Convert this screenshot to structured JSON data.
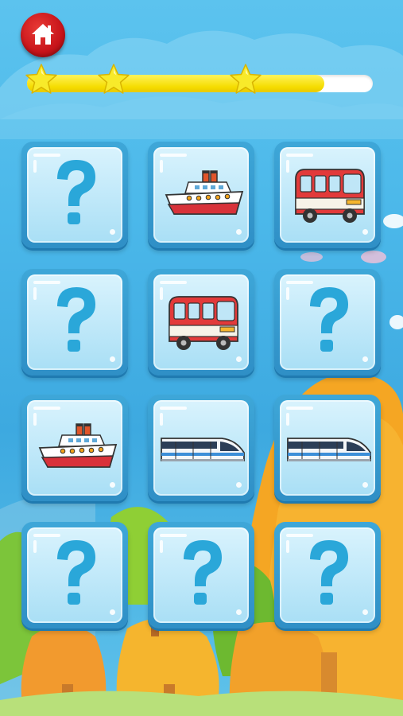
{
  "colors": {
    "sky": "#4bb8ea",
    "card_border": "#2f8fc6",
    "card_face": "#c9ecfb",
    "question_mark": "#2aa7d9",
    "home_button": "#d21a1f",
    "progress_fill": "#f5dc00",
    "star": "#f8ea2a"
  },
  "home_button": {
    "icon": "home-icon"
  },
  "progress": {
    "fraction": 0.86,
    "stars_earned": 3
  },
  "board": {
    "rows": 4,
    "cols": 3,
    "cards": [
      {
        "state": "hidden",
        "icon": "question-mark-icon"
      },
      {
        "state": "revealed",
        "icon": "ship-icon"
      },
      {
        "state": "revealed",
        "icon": "bus-icon"
      },
      {
        "state": "hidden",
        "icon": "question-mark-icon"
      },
      {
        "state": "revealed",
        "icon": "bus-icon"
      },
      {
        "state": "hidden",
        "icon": "question-mark-icon"
      },
      {
        "state": "revealed",
        "icon": "ship-icon"
      },
      {
        "state": "revealed",
        "icon": "train-icon"
      },
      {
        "state": "revealed",
        "icon": "train-icon"
      },
      {
        "state": "hidden",
        "icon": "question-mark-icon"
      },
      {
        "state": "hidden",
        "icon": "question-mark-icon"
      },
      {
        "state": "hidden",
        "icon": "question-mark-icon"
      }
    ]
  }
}
